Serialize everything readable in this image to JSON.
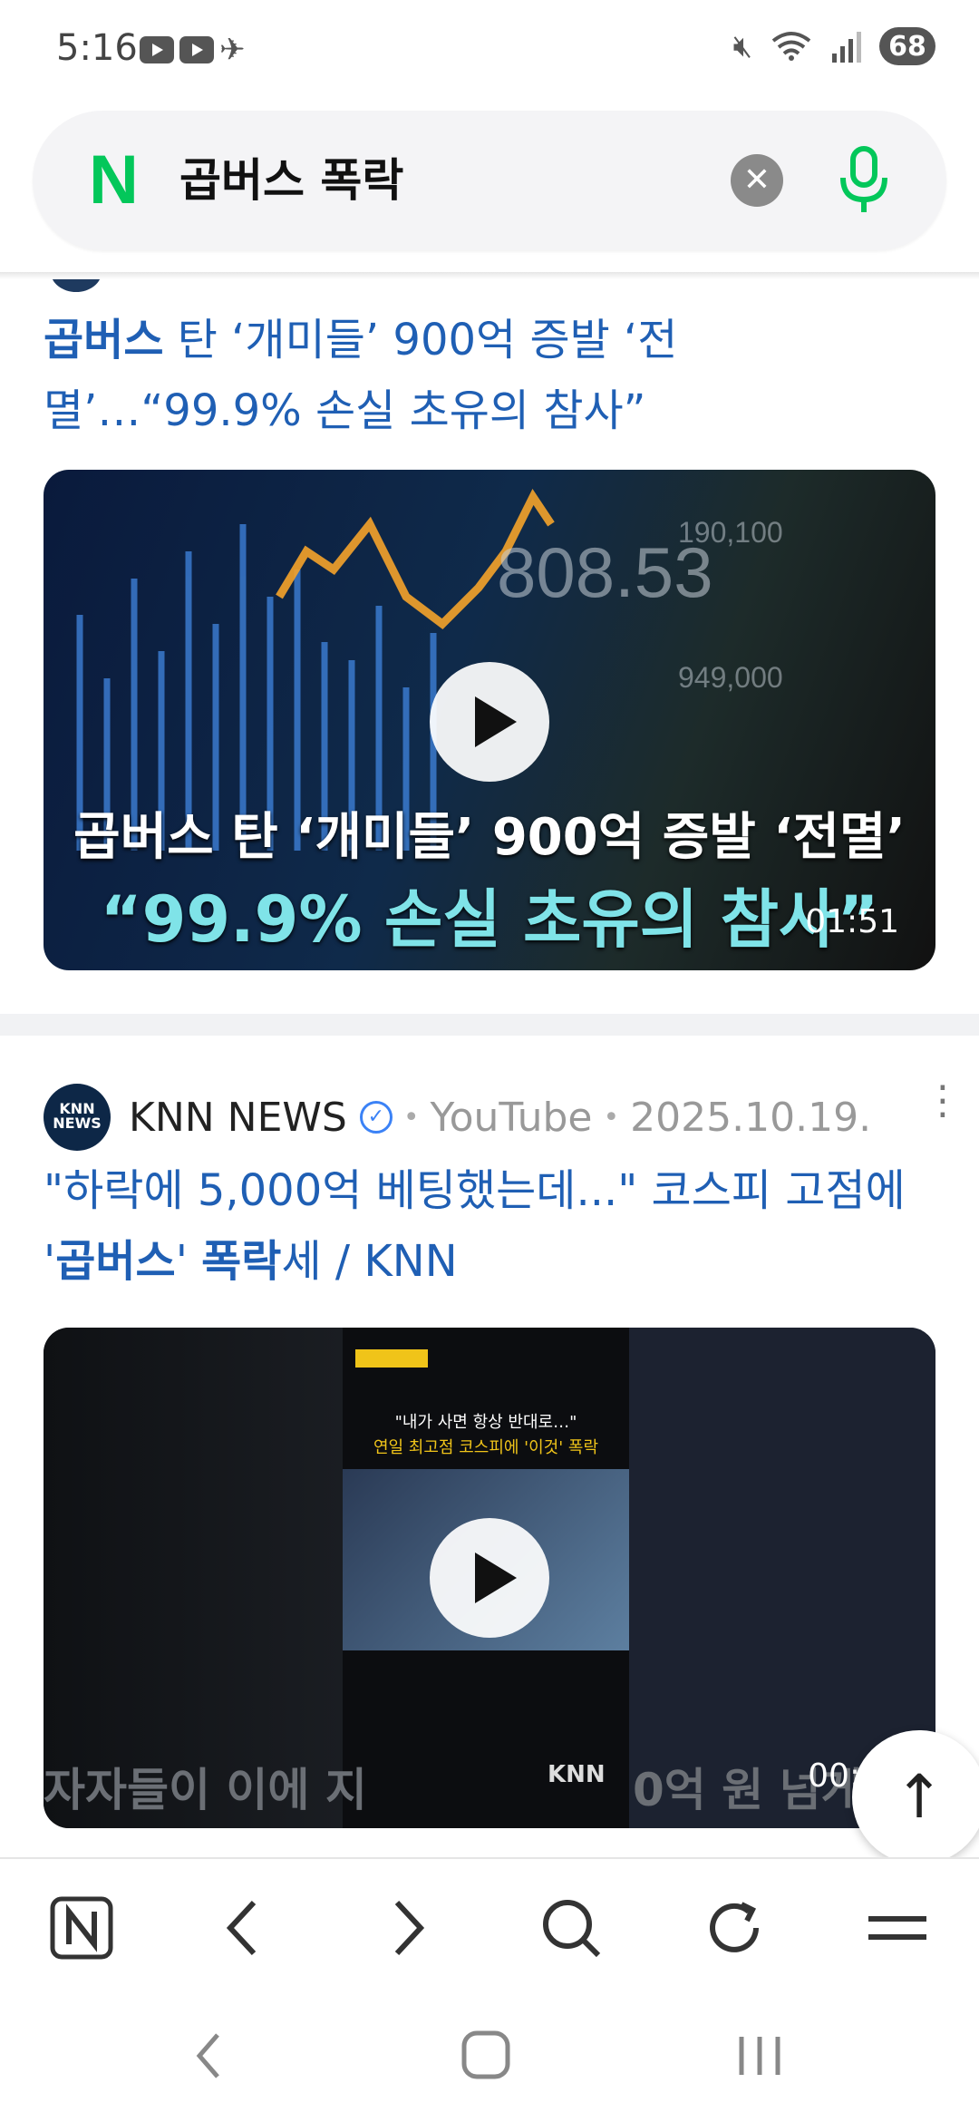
{
  "status": {
    "time": "5:16",
    "battery": "68"
  },
  "search": {
    "query": "곱버스 폭락"
  },
  "item1": {
    "title_bold": "곱버스",
    "title_rest": " 탄 ‘개미들’ 900억 증발 ‘전멸’…“99.9% 손실 초유의 참사”",
    "thumb_caption_1": "곱버스 탄 ‘개미들’ 900억 증발 ‘전멸’",
    "thumb_caption_2": "“99.9% 손실 초유의 참사”",
    "thumb_kospi": "808.53",
    "duration": "01:51"
  },
  "item2": {
    "source": "KNN NEWS",
    "avatar_text_1": "KNN",
    "avatar_text_2": "NEWS",
    "platform": "YouTube",
    "date": "2025.10.19.",
    "title_part1": "\"하락에 5,000억 베팅했는데...\" 코스피 고점에 '",
    "title_bold1": "곱버스",
    "title_part2": "' ",
    "title_bold2": "폭락",
    "title_part3": "세 / KNN",
    "thumb_line1": "\"내가 사면 항상 반대로…\"",
    "thumb_line2": "연일 최고점 코스피에 '이것' 폭락",
    "thumb_bottom": "자자들이 이에 지",
    "thumb_bottom_right": "0억 원 넘게",
    "duration": "00:3"
  },
  "toolbar": {
    "items": [
      "home-n-icon",
      "back-icon",
      "forward-icon",
      "search-icon",
      "refresh-icon",
      "menu-icon"
    ]
  },
  "colors": {
    "title_blue": "#1f5fb4",
    "naver_green": "#03c75a"
  }
}
